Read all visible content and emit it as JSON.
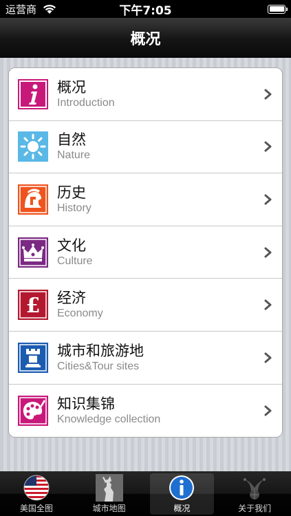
{
  "status_bar": {
    "carrier": "运营商",
    "time": "下午7:05"
  },
  "nav": {
    "title": "概况"
  },
  "menu": {
    "items": [
      {
        "title": "概况",
        "subtitle": "Introduction",
        "icon": "info-icon",
        "color": "#c8187a"
      },
      {
        "title": "自然",
        "subtitle": "Nature",
        "icon": "sun-icon",
        "color": "#5ab8e6"
      },
      {
        "title": "历史",
        "subtitle": "History",
        "icon": "spartan-helmet-icon",
        "color": "#f0541e"
      },
      {
        "title": "文化",
        "subtitle": "Culture",
        "icon": "crown-icon",
        "color": "#7b2a83"
      },
      {
        "title": "经济",
        "subtitle": "Economy",
        "icon": "pound-icon",
        "color": "#b3182f"
      },
      {
        "title": "城市和旅游地",
        "subtitle": "Cities&Tour sites",
        "icon": "rook-icon",
        "color": "#1c5cb0"
      },
      {
        "title": "知识集锦",
        "subtitle": "Knowledge collection",
        "icon": "palette-icon",
        "color": "#c8187a"
      }
    ]
  },
  "tab_bar": {
    "tabs": [
      {
        "label": "美国全图",
        "icon": "us-flag-globe-icon",
        "selected": false
      },
      {
        "label": "城市地图",
        "icon": "statue-of-liberty-icon",
        "selected": false
      },
      {
        "label": "概况",
        "icon": "info-circle-icon",
        "selected": true
      },
      {
        "label": "关于我们",
        "icon": "jester-hat-icon",
        "selected": false
      }
    ]
  }
}
